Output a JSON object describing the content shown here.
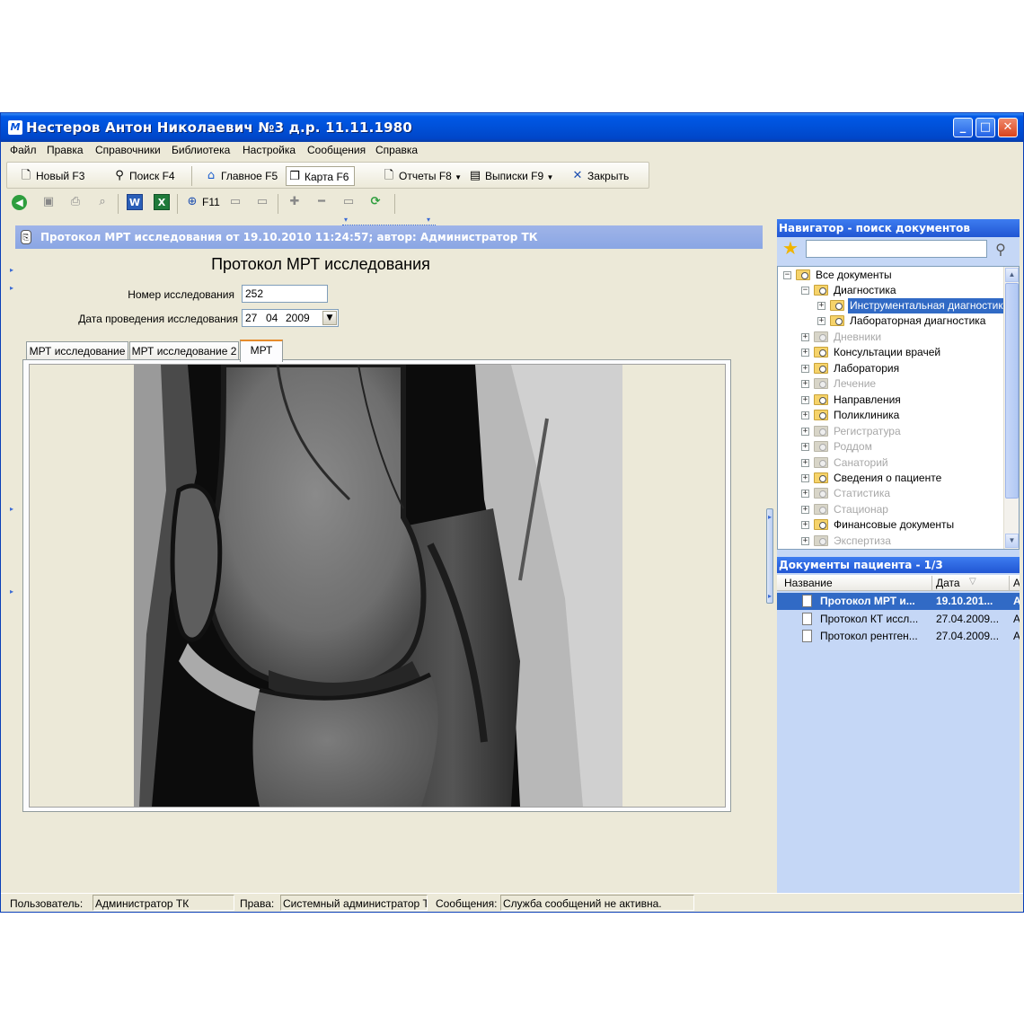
{
  "window": {
    "title": "Нестеров Антон Николаевич  №3  д.р. 11.11.1980",
    "app_icon": "М",
    "minimize": "_",
    "maximize": "□",
    "close": "✕"
  },
  "menu": [
    "Файл",
    "Правка",
    "Справочники",
    "Библиотека",
    "Настройка",
    "Сообщения",
    "Справка"
  ],
  "toolbar": {
    "new": "Новый  F3",
    "search": "Поиск  F4",
    "home": "Главное  F5",
    "card": "Карта  F6",
    "reports": "Отчеты  F8",
    "extracts": "Выписки  F9",
    "close": "Закрыть"
  },
  "toolbar2": {
    "f11": "F11"
  },
  "document": {
    "header": "Протокол МРТ исследования от 19.10.2010 11:24:57; автор: Администратор ТК",
    "title": "Протокол МРТ исследования",
    "number_label": "Номер исследования",
    "number_value": "252",
    "date_label": "Дата проведения исследования",
    "date_day": "27",
    "date_month": "04",
    "date_year": "2009",
    "tabs": [
      "МРТ исследование",
      "МРТ исследование 2",
      "МРТ"
    ]
  },
  "navigator": {
    "title": "Навигатор - поиск документов",
    "search_value": "",
    "tree": [
      {
        "label": "Все документы",
        "state": "normal"
      },
      {
        "label": "Диагностика",
        "state": "normal"
      },
      {
        "label": "Инструментальная диагностика",
        "state": "selected"
      },
      {
        "label": "Лабораторная диагностика",
        "state": "normal"
      },
      {
        "label": "Дневники",
        "state": "disabled"
      },
      {
        "label": "Консультации врачей",
        "state": "normal"
      },
      {
        "label": "Лаборатория",
        "state": "normal"
      },
      {
        "label": "Лечение",
        "state": "disabled"
      },
      {
        "label": "Направления",
        "state": "normal"
      },
      {
        "label": "Поликлиника",
        "state": "normal"
      },
      {
        "label": "Регистратура",
        "state": "disabled"
      },
      {
        "label": "Роддом",
        "state": "disabled"
      },
      {
        "label": "Санаторий",
        "state": "disabled"
      },
      {
        "label": "Сведения о пациенте",
        "state": "normal"
      },
      {
        "label": "Статистика",
        "state": "disabled"
      },
      {
        "label": "Стационар",
        "state": "disabled"
      },
      {
        "label": "Финансовые документы",
        "state": "normal"
      },
      {
        "label": "Экспертиза",
        "state": "disabled"
      }
    ]
  },
  "patient_docs": {
    "title": "Документы пациента  - 1/3",
    "col_name": "Название",
    "col_date": "Дата",
    "col_author": "А",
    "rows": [
      {
        "name": "Протокол МРТ и...",
        "date": "19.10.201...",
        "author": "А"
      },
      {
        "name": "Протокол КТ иссл...",
        "date": "27.04.2009...",
        "author": "А"
      },
      {
        "name": "Протокол рентген...",
        "date": "27.04.2009...",
        "author": "А"
      }
    ]
  },
  "status": {
    "user_label": "Пользователь:",
    "user_value": "Администратор ТК",
    "rights_label": "Права:",
    "rights_value": "Системный администратор Т",
    "messages_label": "Сообщения:",
    "messages_value": "Служба сообщений не активна."
  },
  "colors": {
    "titlebar": "#0050d8",
    "doc_header": "#8aa6e4",
    "navigator_bg": "#c5d7f6",
    "selection": "#316ac5"
  }
}
